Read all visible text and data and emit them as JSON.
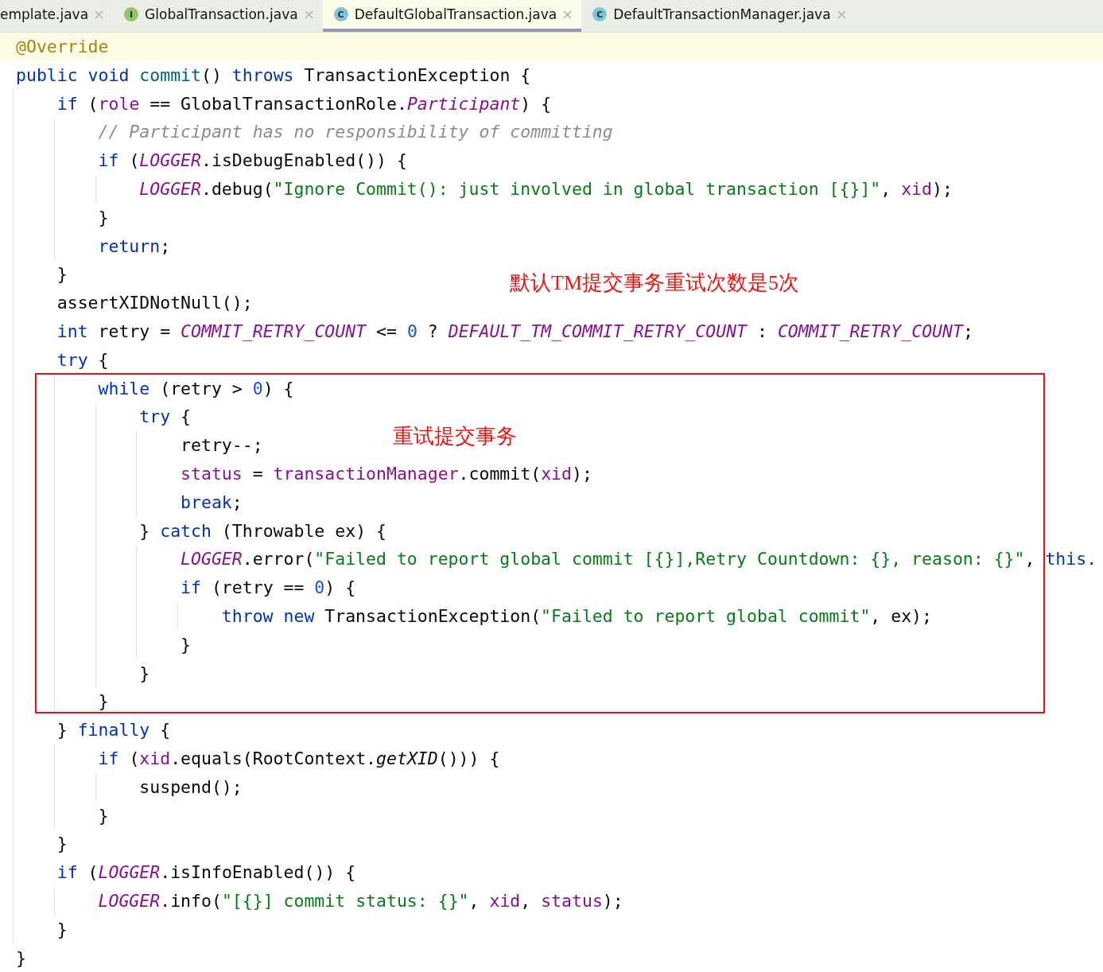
{
  "tabs": [
    {
      "label": "emplate.java",
      "selected": false
    },
    {
      "label": "GlobalTransaction.java",
      "badge": "I",
      "selected": false
    },
    {
      "label": "DefaultGlobalTransaction.java",
      "badge": "C",
      "selected": true
    },
    {
      "label": "DefaultTransactionManager.java",
      "badge": "C",
      "selected": false
    }
  ],
  "code_lines": [
    {
      "current": true,
      "tokens": [
        {
          "kind": "annotation",
          "text": "@Override"
        }
      ]
    },
    {
      "current": false,
      "tokens": [
        {
          "kind": "keyword",
          "text": "public void "
        },
        {
          "kind": "method",
          "text": "commit"
        },
        {
          "kind": "plain",
          "text": "() "
        },
        {
          "kind": "keyword",
          "text": "throws "
        },
        {
          "kind": "plain",
          "text": "TransactionException {"
        }
      ],
      "children": [
        {
          "current": false,
          "tokens": [
            {
              "kind": "keyword",
              "text": "if "
            },
            {
              "kind": "plain",
              "text": "("
            },
            {
              "kind": "field",
              "text": "role"
            },
            {
              "kind": "plain",
              "text": " == GlobalTransactionRole."
            },
            {
              "kind": "static",
              "text": "Participant"
            },
            {
              "kind": "plain",
              "text": ") {"
            }
          ],
          "children": [
            {
              "current": false,
              "tokens": [
                {
                  "kind": "comment",
                  "text": "// Participant has no responsibility of committing"
                }
              ]
            },
            {
              "current": false,
              "tokens": [
                {
                  "kind": "keyword",
                  "text": "if "
                },
                {
                  "kind": "plain",
                  "text": "("
                },
                {
                  "kind": "static",
                  "text": "LOGGER"
                },
                {
                  "kind": "plain",
                  "text": ".isDebugEnabled()) {"
                }
              ],
              "children": [
                {
                  "current": false,
                  "tokens": [
                    {
                      "kind": "static",
                      "text": "LOGGER"
                    },
                    {
                      "kind": "plain",
                      "text": ".debug("
                    },
                    {
                      "kind": "string",
                      "text": "\"Ignore Commit(): just involved in global transaction [{}]\""
                    },
                    {
                      "kind": "plain",
                      "text": ", "
                    },
                    {
                      "kind": "field",
                      "text": "xid"
                    },
                    {
                      "kind": "plain",
                      "text": ");"
                    }
                  ]
                }
              ]
            },
            {
              "current": false,
              "tokens": [
                {
                  "kind": "plain",
                  "text": "}"
                }
              ]
            },
            {
              "current": false,
              "tokens": [
                {
                  "kind": "keyword",
                  "text": "return"
                },
                {
                  "kind": "plain",
                  "text": ";"
                }
              ]
            }
          ]
        },
        {
          "current": false,
          "tokens": [
            {
              "kind": "plain",
              "text": "}"
            }
          ]
        },
        {
          "current": false,
          "tokens": [
            {
              "kind": "plain",
              "text": "assertXIDNotNull();"
            }
          ]
        },
        {
          "current": false,
          "tokens": [
            {
              "kind": "keyword",
              "text": "int "
            },
            {
              "kind": "plain",
              "text": "retry = "
            },
            {
              "kind": "static",
              "text": "COMMIT_RETRY_COUNT"
            },
            {
              "kind": "plain",
              "text": " <= "
            },
            {
              "kind": "number",
              "text": "0"
            },
            {
              "kind": "plain",
              "text": " ? "
            },
            {
              "kind": "static",
              "text": "DEFAULT_TM_COMMIT_RETRY_COUNT"
            },
            {
              "kind": "plain",
              "text": " : "
            },
            {
              "kind": "static",
              "text": "COMMIT_RETRY_COUNT"
            },
            {
              "kind": "plain",
              "text": ";"
            }
          ]
        },
        {
          "current": false,
          "tokens": [
            {
              "kind": "keyword",
              "text": "try "
            },
            {
              "kind": "plain",
              "text": "{"
            }
          ],
          "children": [
            {
              "current": false,
              "tokens": [
                {
                  "kind": "keyword",
                  "text": "while "
                },
                {
                  "kind": "plain",
                  "text": "(retry > "
                },
                {
                  "kind": "number",
                  "text": "0"
                },
                {
                  "kind": "plain",
                  "text": ") {"
                }
              ],
              "children": [
                {
                  "current": false,
                  "tokens": [
                    {
                      "kind": "keyword",
                      "text": "try "
                    },
                    {
                      "kind": "plain",
                      "text": "{"
                    }
                  ],
                  "children": [
                    {
                      "current": false,
                      "tokens": [
                        {
                          "kind": "plain",
                          "text": "retry--;"
                        }
                      ]
                    },
                    {
                      "current": false,
                      "tokens": [
                        {
                          "kind": "field",
                          "text": "status"
                        },
                        {
                          "kind": "plain",
                          "text": " = "
                        },
                        {
                          "kind": "field",
                          "text": "transactionManager"
                        },
                        {
                          "kind": "plain",
                          "text": ".commit("
                        },
                        {
                          "kind": "field",
                          "text": "xid"
                        },
                        {
                          "kind": "plain",
                          "text": ");"
                        }
                      ]
                    },
                    {
                      "current": false,
                      "tokens": [
                        {
                          "kind": "keyword",
                          "text": "break"
                        },
                        {
                          "kind": "plain",
                          "text": ";"
                        }
                      ]
                    }
                  ]
                },
                {
                  "current": false,
                  "tokens": [
                    {
                      "kind": "plain",
                      "text": "} "
                    },
                    {
                      "kind": "keyword",
                      "text": "catch "
                    },
                    {
                      "kind": "plain",
                      "text": "(Throwable ex) {"
                    }
                  ],
                  "children": [
                    {
                      "current": false,
                      "tokens": [
                        {
                          "kind": "static",
                          "text": "LOGGER"
                        },
                        {
                          "kind": "plain",
                          "text": ".error("
                        },
                        {
                          "kind": "string",
                          "text": "\"Failed to report global commit [{}],Retry Countdown: {}, reason: {}\""
                        },
                        {
                          "kind": "plain",
                          "text": ", "
                        },
                        {
                          "kind": "keyword",
                          "text": "this."
                        }
                      ]
                    },
                    {
                      "current": false,
                      "tokens": [
                        {
                          "kind": "keyword",
                          "text": "if "
                        },
                        {
                          "kind": "plain",
                          "text": "(retry == "
                        },
                        {
                          "kind": "number",
                          "text": "0"
                        },
                        {
                          "kind": "plain",
                          "text": ") {"
                        }
                      ],
                      "children": [
                        {
                          "current": false,
                          "tokens": [
                            {
                              "kind": "keyword",
                              "text": "throw new "
                            },
                            {
                              "kind": "plain",
                              "text": "TransactionException("
                            },
                            {
                              "kind": "string",
                              "text": "\"Failed to report global commit\""
                            },
                            {
                              "kind": "plain",
                              "text": ", ex);"
                            }
                          ]
                        }
                      ]
                    },
                    {
                      "current": false,
                      "tokens": [
                        {
                          "kind": "plain",
                          "text": "}"
                        }
                      ]
                    }
                  ]
                },
                {
                  "current": false,
                  "tokens": [
                    {
                      "kind": "plain",
                      "text": "}"
                    }
                  ]
                }
              ]
            },
            {
              "current": false,
              "tokens": [
                {
                  "kind": "plain",
                  "text": "}"
                }
              ]
            }
          ]
        },
        {
          "current": false,
          "tokens": [
            {
              "kind": "plain",
              "text": "} "
            },
            {
              "kind": "keyword",
              "text": "finally "
            },
            {
              "kind": "plain",
              "text": "{"
            }
          ],
          "children": [
            {
              "current": false,
              "tokens": [
                {
                  "kind": "keyword",
                  "text": "if "
                },
                {
                  "kind": "plain",
                  "text": "("
                },
                {
                  "kind": "field",
                  "text": "xid"
                },
                {
                  "kind": "plain",
                  "text": ".equals(RootContext."
                },
                {
                  "kind": "static_method",
                  "text": "getXID"
                },
                {
                  "kind": "plain",
                  "text": "())) {"
                }
              ],
              "children": [
                {
                  "current": false,
                  "tokens": [
                    {
                      "kind": "plain",
                      "text": "suspend();"
                    }
                  ]
                }
              ]
            },
            {
              "current": false,
              "tokens": [
                {
                  "kind": "plain",
                  "text": "}"
                }
              ]
            }
          ]
        },
        {
          "current": false,
          "tokens": [
            {
              "kind": "plain",
              "text": "}"
            }
          ]
        },
        {
          "current": false,
          "tokens": [
            {
              "kind": "keyword",
              "text": "if "
            },
            {
              "kind": "plain",
              "text": "("
            },
            {
              "kind": "static",
              "text": "LOGGER"
            },
            {
              "kind": "plain",
              "text": ".isInfoEnabled()) {"
            }
          ],
          "children": [
            {
              "current": false,
              "tokens": [
                {
                  "kind": "static",
                  "text": "LOGGER"
                },
                {
                  "kind": "plain",
                  "text": ".info("
                },
                {
                  "kind": "string",
                  "text": "\"[{}] commit status: {}\""
                },
                {
                  "kind": "plain",
                  "text": ", "
                },
                {
                  "kind": "field",
                  "text": "xid"
                },
                {
                  "kind": "plain",
                  "text": ", "
                },
                {
                  "kind": "field",
                  "text": "status"
                },
                {
                  "kind": "plain",
                  "text": ");"
                }
              ]
            }
          ]
        },
        {
          "current": false,
          "tokens": [
            {
              "kind": "plain",
              "text": "}"
            }
          ]
        }
      ]
    },
    {
      "current": false,
      "tokens": [
        {
          "kind": "plain",
          "text": "}"
        }
      ]
    }
  ],
  "annotations": [
    {
      "text": "默认TM提交事务重试次数是5次"
    },
    {
      "text": "重试提交事务"
    }
  ]
}
